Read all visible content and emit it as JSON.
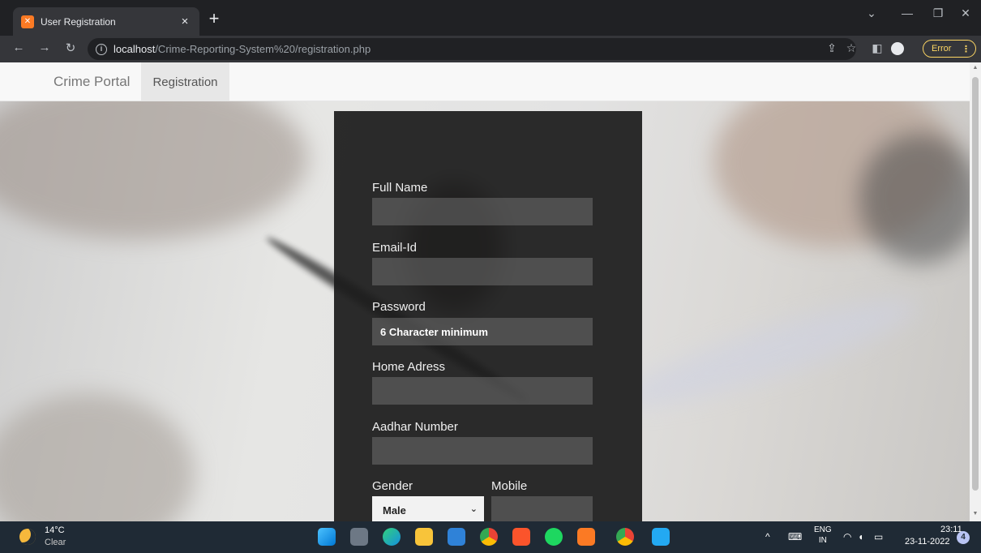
{
  "browser": {
    "tab_title": "User Registration",
    "tab_favicon_icon": "xampp-icon",
    "tab_close": "×",
    "new_tab": "+",
    "url_host": "localhost",
    "url_path": "/Crime-Reporting-System%20/registration.php",
    "error_label": "Error",
    "error_menu": "⋮",
    "window_controls": {
      "dropdown": "⌄",
      "minimize": "—",
      "restore": "❐",
      "close": "✕"
    }
  },
  "navbar": {
    "brand": "Crime Portal",
    "active_item": "Registration"
  },
  "form": {
    "full_name_label": "Full Name",
    "email_label": "Email-Id",
    "password_label": "Password",
    "password_placeholder": "6 Character minimum",
    "address_label": "Home Adress",
    "aadhar_label": "Aadhar Number",
    "gender_label": "Gender",
    "gender_selected": "Male",
    "mobile_label": "Mobile"
  },
  "taskbar": {
    "temperature": "14°C",
    "condition": "Clear",
    "lang_primary": "ENG",
    "lang_region": "IN",
    "time": "23:11",
    "date": "23-11-2022",
    "notification_count": "4"
  },
  "colors": {
    "panel": "#1c1c1c",
    "error_accent": "#fdd663",
    "taskbar": "#1f2a35"
  }
}
